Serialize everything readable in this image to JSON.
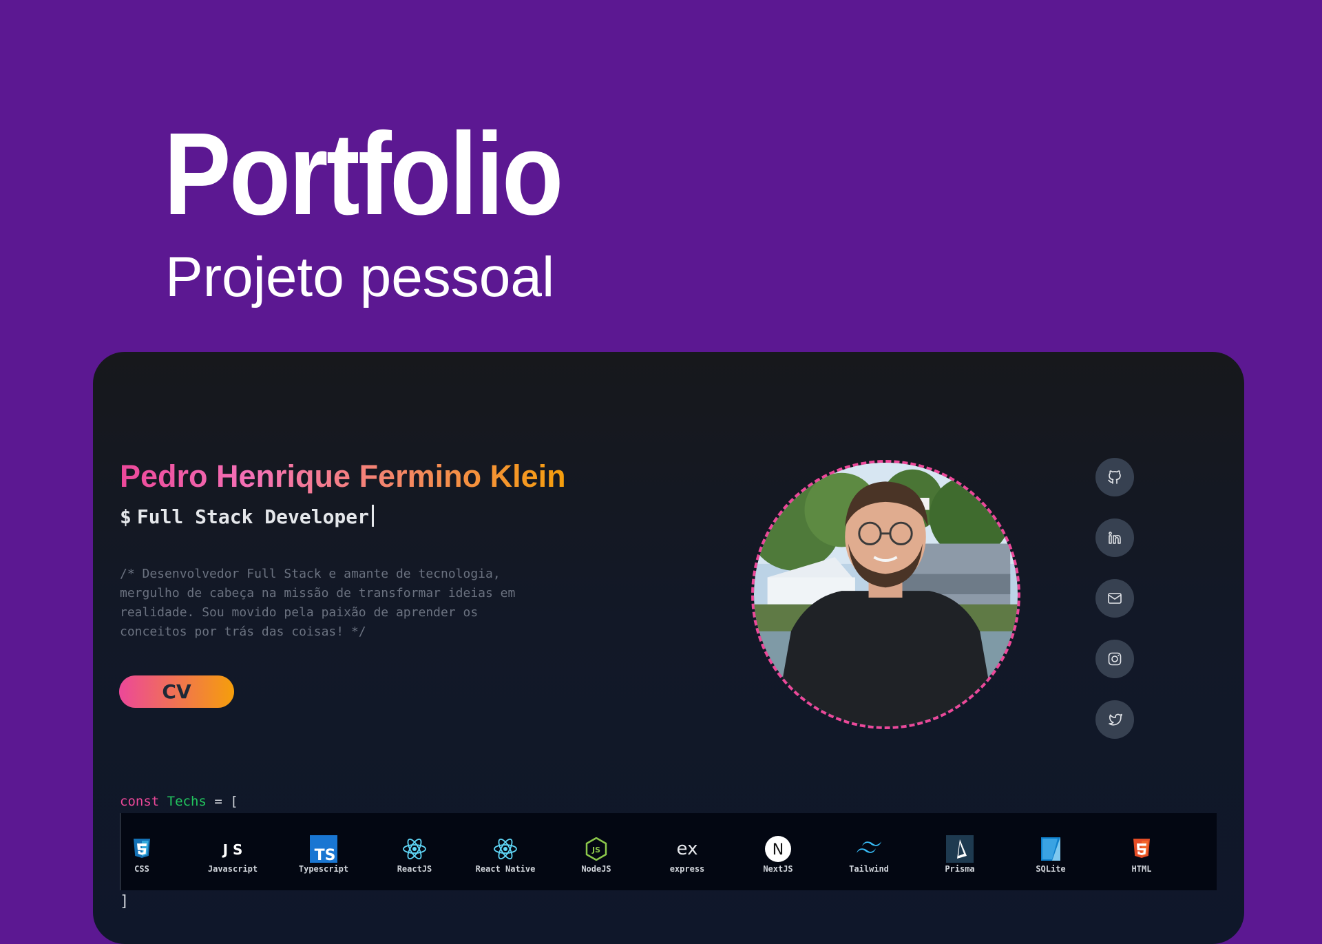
{
  "hero": {
    "title": "Portfolio",
    "subtitle": "Projeto pessoal"
  },
  "profile": {
    "name": "Pedro Henrique Fermino Klein",
    "prompt": "$",
    "role": "Full Stack Developer",
    "bio": "/* Desenvolvedor Full Stack e amante de tecnologia, mergulho de cabeça na missão de transformar ideias em realidade. Sou movido pela paixão de aprender os conceitos por trás das coisas! */",
    "cv_label": "CV"
  },
  "social": [
    "github-icon",
    "linkedin-icon",
    "mail-icon",
    "instagram-icon",
    "twitter-icon"
  ],
  "techs": {
    "open_keyword": "const",
    "open_name": "Techs",
    "open_rest": "= [",
    "close": "]",
    "items": [
      {
        "label": "CSS",
        "icon": "css-icon"
      },
      {
        "label": "Javascript",
        "icon": "javascript-icon"
      },
      {
        "label": "Typescript",
        "icon": "typescript-icon"
      },
      {
        "label": "ReactJS",
        "icon": "react-icon"
      },
      {
        "label": "React Native",
        "icon": "react-native-icon"
      },
      {
        "label": "NodeJS",
        "icon": "nodejs-icon"
      },
      {
        "label": "express",
        "icon": "express-icon"
      },
      {
        "label": "NextJS",
        "icon": "nextjs-icon"
      },
      {
        "label": "Tailwind",
        "icon": "tailwind-icon"
      },
      {
        "label": "Prisma",
        "icon": "prisma-icon"
      },
      {
        "label": "SQLite",
        "icon": "sqlite-icon"
      },
      {
        "label": "HTML",
        "icon": "html-icon"
      }
    ]
  },
  "colors": {
    "background": "#5c1892",
    "accent_pink": "#ec4899",
    "accent_orange": "#f59e0b"
  }
}
